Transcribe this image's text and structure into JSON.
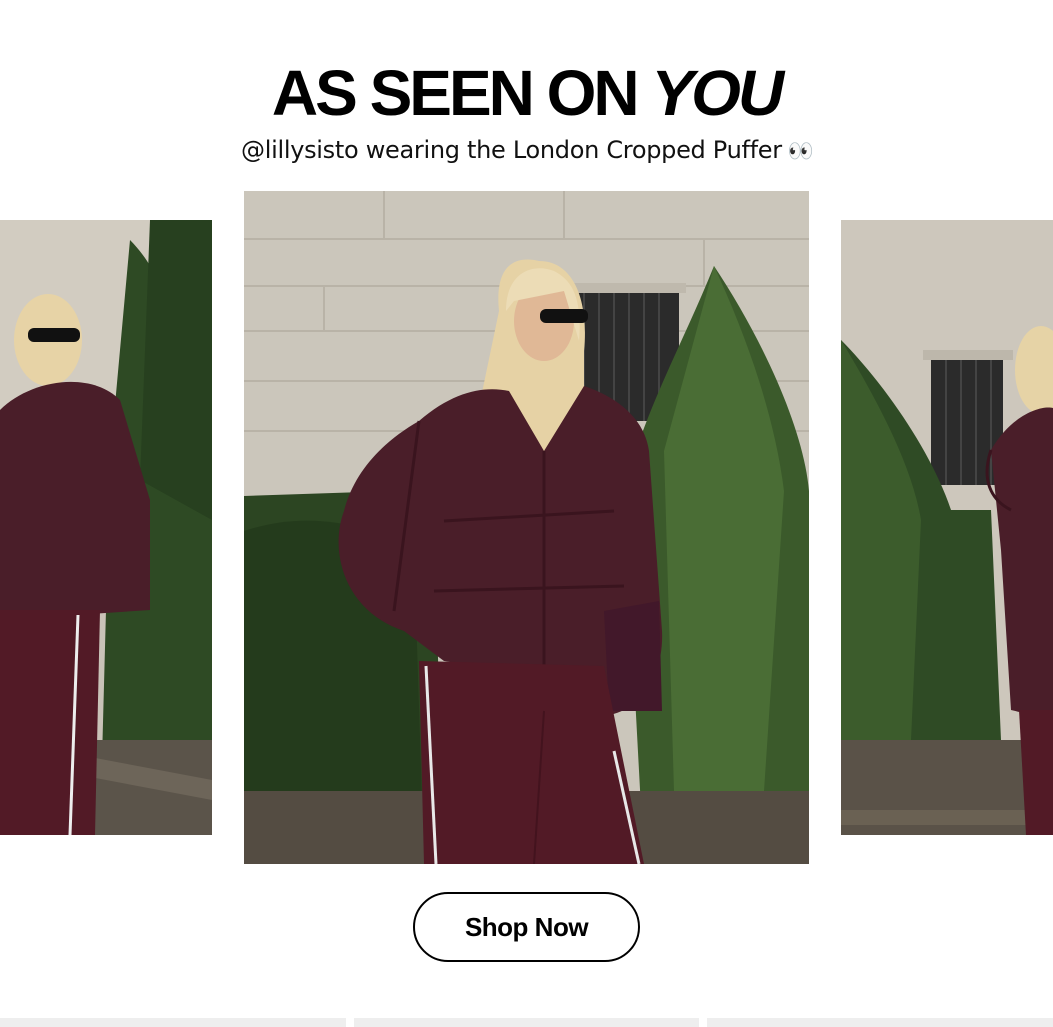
{
  "header": {
    "headline_part1": "AS SEEN ON ",
    "headline_part2": "YOU",
    "subline_text": "@lillysisto wearing the London Cropped Puffer",
    "subline_emoji": "👀"
  },
  "carousel": {
    "slides": [
      {
        "id": "left",
        "image_icon": "photo-woman-puffer-left-icon"
      },
      {
        "id": "main",
        "image_icon": "photo-woman-puffer-main-icon"
      },
      {
        "id": "right",
        "image_icon": "photo-woman-puffer-right-icon"
      }
    ]
  },
  "cta": {
    "label": "Shop Now"
  },
  "colors": {
    "jacket": "#4a1e29",
    "pants": "#521a26",
    "hedge": "#2f4a25",
    "wall": "#cdc8bd",
    "button_border": "#000000"
  }
}
